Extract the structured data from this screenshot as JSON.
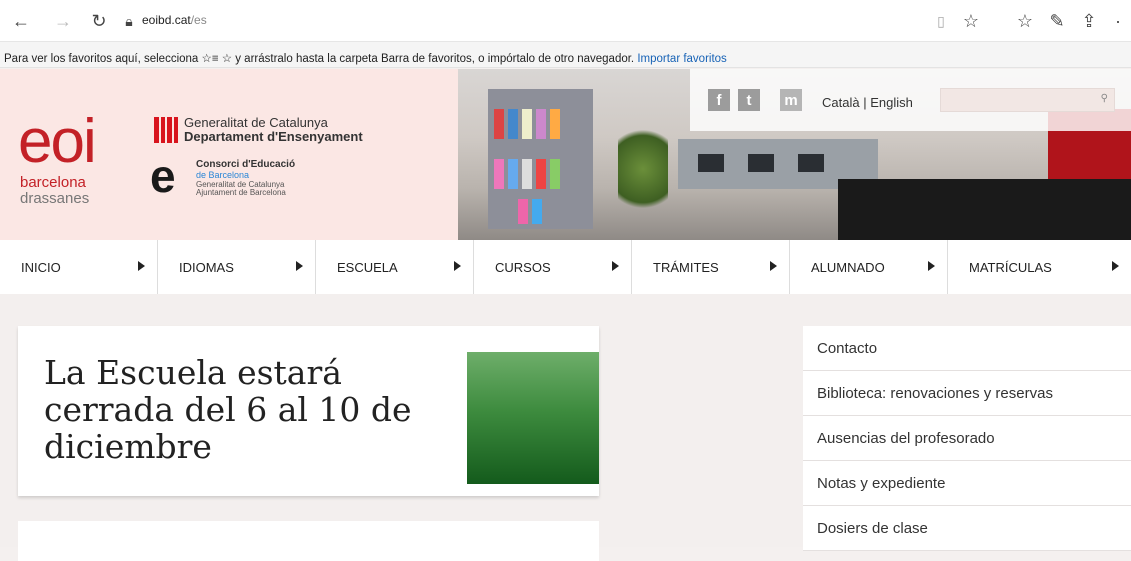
{
  "browser": {
    "url_domain": "eoibd.cat",
    "url_path": "/es",
    "favorites_bar_text": "Para ver los favoritos aquí, selecciona ☆≡ ☆ y arrástralo hasta la carpeta Barra de favoritos, o impórtalo de otro navegador.",
    "favorites_bar_link": "Importar favoritos"
  },
  "header": {
    "logo_eoi": "eoi",
    "logo_barcelona": "barcelona",
    "logo_drassanes": "drassanes",
    "gencat_line1": "Generalitat de Catalunya",
    "gencat_line2": "Departament d'Ensenyament",
    "consorci_e": "e",
    "consorci_line1": "Consorci d'Educació",
    "consorci_line2": "de Barcelona",
    "consorci_line3": "Generalitat de Catalunya",
    "consorci_line4": "Ajuntament de Barcelona",
    "social": [
      "f",
      "t",
      "m"
    ],
    "lang_ca": "Català",
    "lang_sep": " | ",
    "lang_en": "English",
    "search_placeholder": ""
  },
  "nav": {
    "items": [
      "INICIO",
      "IDIOMAS",
      "ESCUELA",
      "CURSOS",
      "TRÁMITES",
      "ALUMNADO",
      "MATRÍCULAS"
    ]
  },
  "news": {
    "title": "La Escuela estará cerrada del 6 al 10 de diciembre"
  },
  "sidebar": {
    "items": [
      "Contacto",
      "Biblioteca: renovaciones y reservas",
      "Ausencias del profesorado",
      "Notas y expediente",
      "Dosiers de clase"
    ]
  }
}
